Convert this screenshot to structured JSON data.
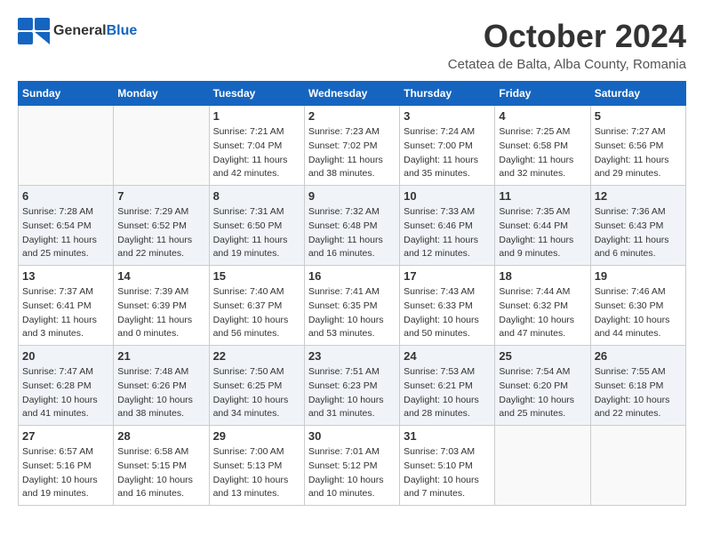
{
  "header": {
    "logo_general": "General",
    "logo_blue": "Blue",
    "month_title": "October 2024",
    "location": "Cetatea de Balta, Alba County, Romania"
  },
  "weekdays": [
    "Sunday",
    "Monday",
    "Tuesday",
    "Wednesday",
    "Thursday",
    "Friday",
    "Saturday"
  ],
  "weeks": [
    [
      {
        "day": "",
        "info": ""
      },
      {
        "day": "",
        "info": ""
      },
      {
        "day": "1",
        "info": "Sunrise: 7:21 AM\nSunset: 7:04 PM\nDaylight: 11 hours and 42 minutes."
      },
      {
        "day": "2",
        "info": "Sunrise: 7:23 AM\nSunset: 7:02 PM\nDaylight: 11 hours and 38 minutes."
      },
      {
        "day": "3",
        "info": "Sunrise: 7:24 AM\nSunset: 7:00 PM\nDaylight: 11 hours and 35 minutes."
      },
      {
        "day": "4",
        "info": "Sunrise: 7:25 AM\nSunset: 6:58 PM\nDaylight: 11 hours and 32 minutes."
      },
      {
        "day": "5",
        "info": "Sunrise: 7:27 AM\nSunset: 6:56 PM\nDaylight: 11 hours and 29 minutes."
      }
    ],
    [
      {
        "day": "6",
        "info": "Sunrise: 7:28 AM\nSunset: 6:54 PM\nDaylight: 11 hours and 25 minutes."
      },
      {
        "day": "7",
        "info": "Sunrise: 7:29 AM\nSunset: 6:52 PM\nDaylight: 11 hours and 22 minutes."
      },
      {
        "day": "8",
        "info": "Sunrise: 7:31 AM\nSunset: 6:50 PM\nDaylight: 11 hours and 19 minutes."
      },
      {
        "day": "9",
        "info": "Sunrise: 7:32 AM\nSunset: 6:48 PM\nDaylight: 11 hours and 16 minutes."
      },
      {
        "day": "10",
        "info": "Sunrise: 7:33 AM\nSunset: 6:46 PM\nDaylight: 11 hours and 12 minutes."
      },
      {
        "day": "11",
        "info": "Sunrise: 7:35 AM\nSunset: 6:44 PM\nDaylight: 11 hours and 9 minutes."
      },
      {
        "day": "12",
        "info": "Sunrise: 7:36 AM\nSunset: 6:43 PM\nDaylight: 11 hours and 6 minutes."
      }
    ],
    [
      {
        "day": "13",
        "info": "Sunrise: 7:37 AM\nSunset: 6:41 PM\nDaylight: 11 hours and 3 minutes."
      },
      {
        "day": "14",
        "info": "Sunrise: 7:39 AM\nSunset: 6:39 PM\nDaylight: 11 hours and 0 minutes."
      },
      {
        "day": "15",
        "info": "Sunrise: 7:40 AM\nSunset: 6:37 PM\nDaylight: 10 hours and 56 minutes."
      },
      {
        "day": "16",
        "info": "Sunrise: 7:41 AM\nSunset: 6:35 PM\nDaylight: 10 hours and 53 minutes."
      },
      {
        "day": "17",
        "info": "Sunrise: 7:43 AM\nSunset: 6:33 PM\nDaylight: 10 hours and 50 minutes."
      },
      {
        "day": "18",
        "info": "Sunrise: 7:44 AM\nSunset: 6:32 PM\nDaylight: 10 hours and 47 minutes."
      },
      {
        "day": "19",
        "info": "Sunrise: 7:46 AM\nSunset: 6:30 PM\nDaylight: 10 hours and 44 minutes."
      }
    ],
    [
      {
        "day": "20",
        "info": "Sunrise: 7:47 AM\nSunset: 6:28 PM\nDaylight: 10 hours and 41 minutes."
      },
      {
        "day": "21",
        "info": "Sunrise: 7:48 AM\nSunset: 6:26 PM\nDaylight: 10 hours and 38 minutes."
      },
      {
        "day": "22",
        "info": "Sunrise: 7:50 AM\nSunset: 6:25 PM\nDaylight: 10 hours and 34 minutes."
      },
      {
        "day": "23",
        "info": "Sunrise: 7:51 AM\nSunset: 6:23 PM\nDaylight: 10 hours and 31 minutes."
      },
      {
        "day": "24",
        "info": "Sunrise: 7:53 AM\nSunset: 6:21 PM\nDaylight: 10 hours and 28 minutes."
      },
      {
        "day": "25",
        "info": "Sunrise: 7:54 AM\nSunset: 6:20 PM\nDaylight: 10 hours and 25 minutes."
      },
      {
        "day": "26",
        "info": "Sunrise: 7:55 AM\nSunset: 6:18 PM\nDaylight: 10 hours and 22 minutes."
      }
    ],
    [
      {
        "day": "27",
        "info": "Sunrise: 6:57 AM\nSunset: 5:16 PM\nDaylight: 10 hours and 19 minutes."
      },
      {
        "day": "28",
        "info": "Sunrise: 6:58 AM\nSunset: 5:15 PM\nDaylight: 10 hours and 16 minutes."
      },
      {
        "day": "29",
        "info": "Sunrise: 7:00 AM\nSunset: 5:13 PM\nDaylight: 10 hours and 13 minutes."
      },
      {
        "day": "30",
        "info": "Sunrise: 7:01 AM\nSunset: 5:12 PM\nDaylight: 10 hours and 10 minutes."
      },
      {
        "day": "31",
        "info": "Sunrise: 7:03 AM\nSunset: 5:10 PM\nDaylight: 10 hours and 7 minutes."
      },
      {
        "day": "",
        "info": ""
      },
      {
        "day": "",
        "info": ""
      }
    ]
  ]
}
